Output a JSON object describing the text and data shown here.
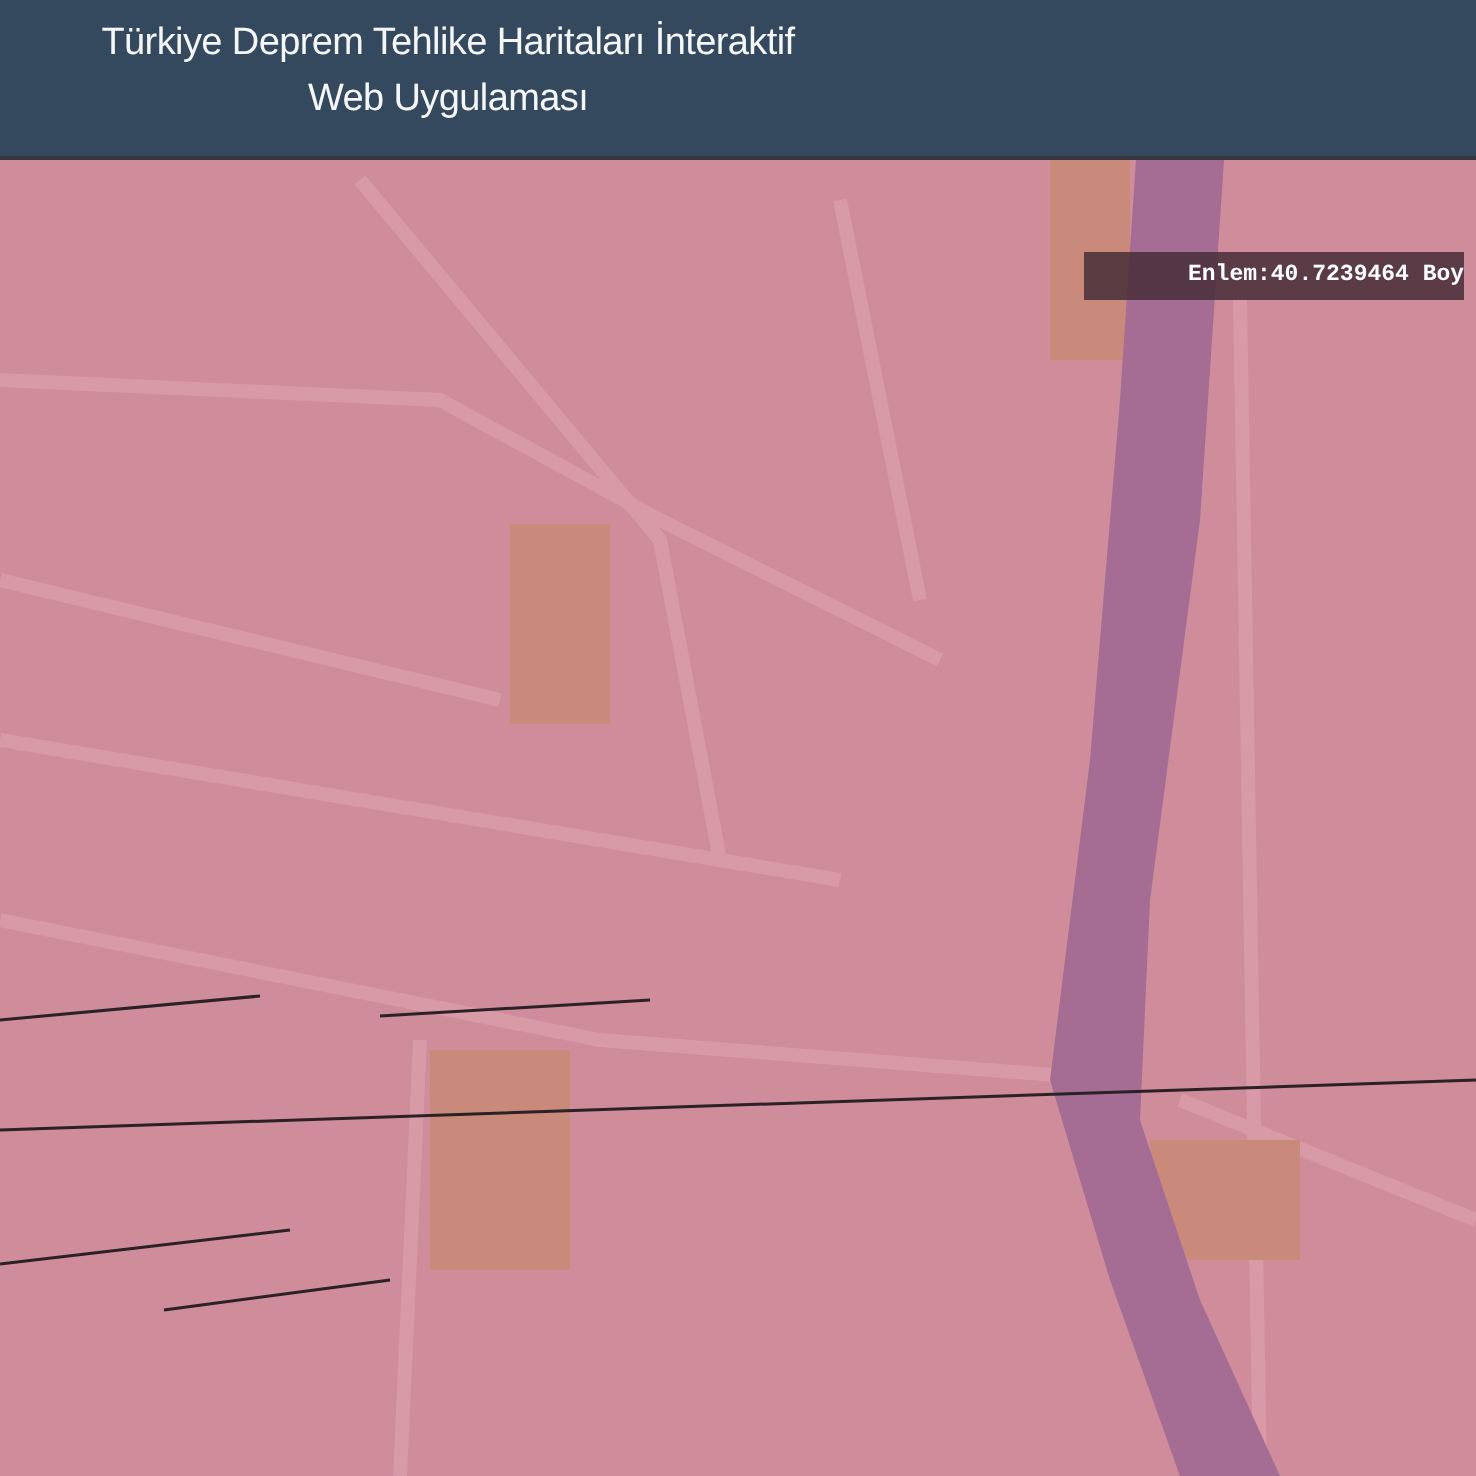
{
  "header": {
    "title": "Türkiye Deprem Tehlike Haritaları İnteraktif Web Uygulaması"
  },
  "map": {
    "coordinate_tooltip": "Enlem:40.7239464 Boy"
  }
}
